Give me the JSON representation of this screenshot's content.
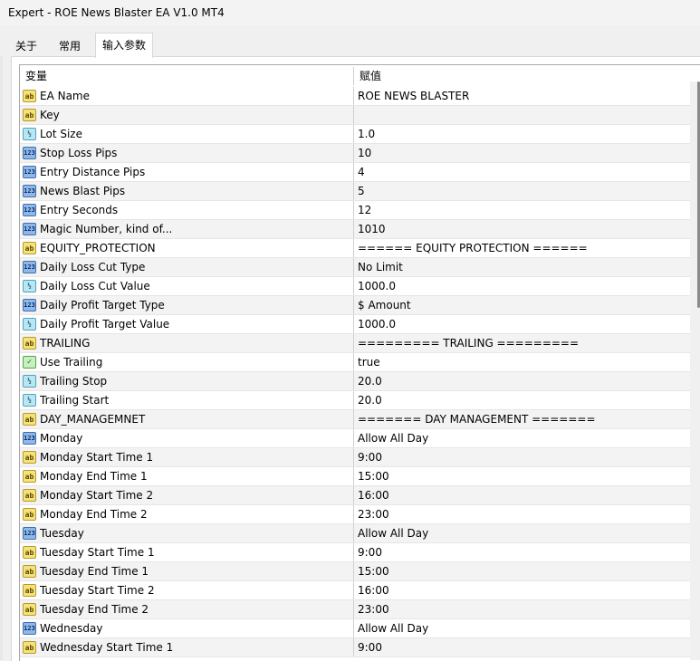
{
  "window": {
    "title": "Expert - ROE News Blaster EA V1.0 MT4"
  },
  "tabs": [
    {
      "label": "关于",
      "active": false
    },
    {
      "label": "常用",
      "active": false
    },
    {
      "label": "输入参数",
      "active": true
    }
  ],
  "table": {
    "headers": {
      "variable": "变量",
      "value": "赋值"
    },
    "rows": [
      {
        "type": "ab",
        "icon": "string-icon",
        "name": "EA Name",
        "value": "ROE NEWS BLASTER"
      },
      {
        "type": "ab",
        "icon": "string-icon",
        "name": "Key",
        "value": ""
      },
      {
        "type": "dbl",
        "icon": "double-icon",
        "name": "Lot Size",
        "value": "1.0"
      },
      {
        "type": "num",
        "icon": "integer-icon",
        "name": "Stop Loss Pips",
        "value": "10"
      },
      {
        "type": "num",
        "icon": "integer-icon",
        "name": "Entry Distance Pips",
        "value": "4"
      },
      {
        "type": "num",
        "icon": "integer-icon",
        "name": "News Blast Pips",
        "value": "5"
      },
      {
        "type": "num",
        "icon": "integer-icon",
        "name": "Entry Seconds",
        "value": "12"
      },
      {
        "type": "num",
        "icon": "integer-icon",
        "name": "Magic Number, kind of...",
        "value": "1010"
      },
      {
        "type": "ab",
        "icon": "string-icon",
        "name": "EQUITY_PROTECTION",
        "value": "====== EQUITY PROTECTION ======"
      },
      {
        "type": "num",
        "icon": "integer-icon",
        "name": "Daily Loss Cut Type",
        "value": "No Limit"
      },
      {
        "type": "dbl",
        "icon": "double-icon",
        "name": "Daily Loss Cut Value",
        "value": "1000.0"
      },
      {
        "type": "num",
        "icon": "integer-icon",
        "name": "Daily Profit Target Type",
        "value": "$ Amount"
      },
      {
        "type": "dbl",
        "icon": "double-icon",
        "name": "Daily Profit Target Value",
        "value": "1000.0"
      },
      {
        "type": "ab",
        "icon": "string-icon",
        "name": "TRAILING",
        "value": "========= TRAILING ========="
      },
      {
        "type": "bool",
        "icon": "bool-icon",
        "name": "Use Trailing",
        "value": "true"
      },
      {
        "type": "dbl",
        "icon": "double-icon",
        "name": "Trailing Stop",
        "value": "20.0"
      },
      {
        "type": "dbl",
        "icon": "double-icon",
        "name": "Trailing Start",
        "value": "20.0"
      },
      {
        "type": "ab",
        "icon": "string-icon",
        "name": "DAY_MANAGEMNET",
        "value": "======= DAY MANAGEMENT ======="
      },
      {
        "type": "num",
        "icon": "integer-icon",
        "name": "Monday",
        "value": "Allow All Day"
      },
      {
        "type": "ab",
        "icon": "string-icon",
        "name": "Monday Start Time 1",
        "value": "9:00"
      },
      {
        "type": "ab",
        "icon": "string-icon",
        "name": "Monday End Time 1",
        "value": "15:00"
      },
      {
        "type": "ab",
        "icon": "string-icon",
        "name": "Monday Start Time 2",
        "value": "16:00"
      },
      {
        "type": "ab",
        "icon": "string-icon",
        "name": "Monday End Time 2",
        "value": "23:00"
      },
      {
        "type": "num",
        "icon": "integer-icon",
        "name": "Tuesday",
        "value": "Allow All Day"
      },
      {
        "type": "ab",
        "icon": "string-icon",
        "name": "Tuesday Start Time 1",
        "value": "9:00"
      },
      {
        "type": "ab",
        "icon": "string-icon",
        "name": "Tuesday End Time 1",
        "value": "15:00"
      },
      {
        "type": "ab",
        "icon": "string-icon",
        "name": "Tuesday Start Time 2",
        "value": "16:00"
      },
      {
        "type": "ab",
        "icon": "string-icon",
        "name": "Tuesday End Time 2",
        "value": "23:00"
      },
      {
        "type": "num",
        "icon": "integer-icon",
        "name": "Wednesday",
        "value": "Allow All Day"
      },
      {
        "type": "ab",
        "icon": "string-icon",
        "name": "Wednesday Start Time 1",
        "value": "9:00"
      }
    ]
  }
}
